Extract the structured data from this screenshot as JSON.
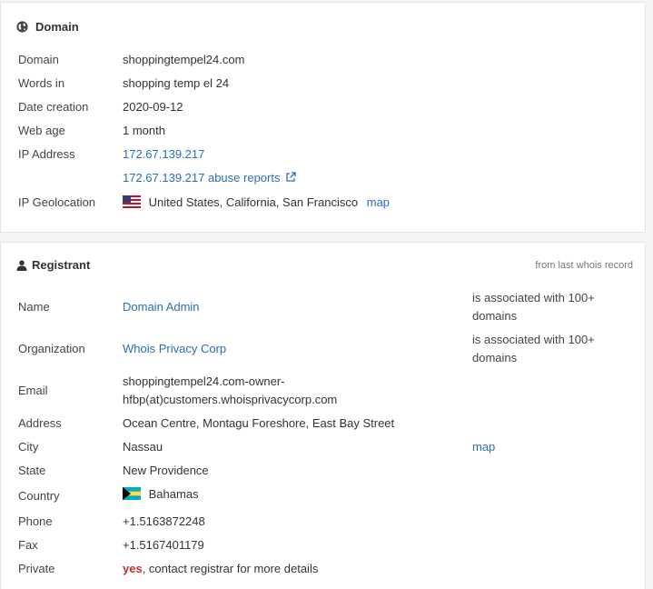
{
  "domain_section": {
    "title": "Domain",
    "domain": {
      "label": "Domain",
      "value": "shoppingtempel24.com"
    },
    "words_in": {
      "label": "Words in",
      "value": "shopping temp el 24"
    },
    "date_creation": {
      "label": "Date creation",
      "value": "2020-09-12"
    },
    "web_age": {
      "label": "Web age",
      "value": "1 month"
    },
    "ip_address": {
      "label": "IP Address",
      "value": "172.67.139.217",
      "abuse_link": "172.67.139.217 abuse reports"
    },
    "ip_geolocation": {
      "label": "IP Geolocation",
      "value": "United States, California, San Francisco",
      "map_link": "map",
      "flag_icon": "us-flag-icon"
    }
  },
  "registrant_section": {
    "title": "Registrant",
    "note": "from last whois record",
    "name": {
      "label": "Name",
      "value": "Domain Admin",
      "assoc": "is associated with 100+",
      "assoc2": "domains"
    },
    "organization": {
      "label": "Organization",
      "value": "Whois Privacy Corp",
      "assoc": "is associated with 100+",
      "assoc2": "domains"
    },
    "email": {
      "label": "Email",
      "value_line1": "shoppingtempel24.com-owner-",
      "value_line2": "hfbp(at)customers.whoisprivacycorp.com"
    },
    "address": {
      "label": "Address",
      "value": "Ocean Centre, Montagu Foreshore, East Bay Street"
    },
    "city": {
      "label": "City",
      "value": "Nassau",
      "map_link": "map"
    },
    "state": {
      "label": "State",
      "value": "New Providence"
    },
    "country": {
      "label": "Country",
      "value": "Bahamas",
      "flag_icon": "bahamas-flag-icon"
    },
    "phone": {
      "label": "Phone",
      "value": "+1.5163872248"
    },
    "fax": {
      "label": "Fax",
      "value": "+1.5167401179"
    },
    "private": {
      "label": "Private",
      "value_bold": "yes",
      "value_rest": ", contact registrar for more details"
    }
  },
  "colors": {
    "link": "#2a6eb5",
    "alert": "#c9302c"
  }
}
